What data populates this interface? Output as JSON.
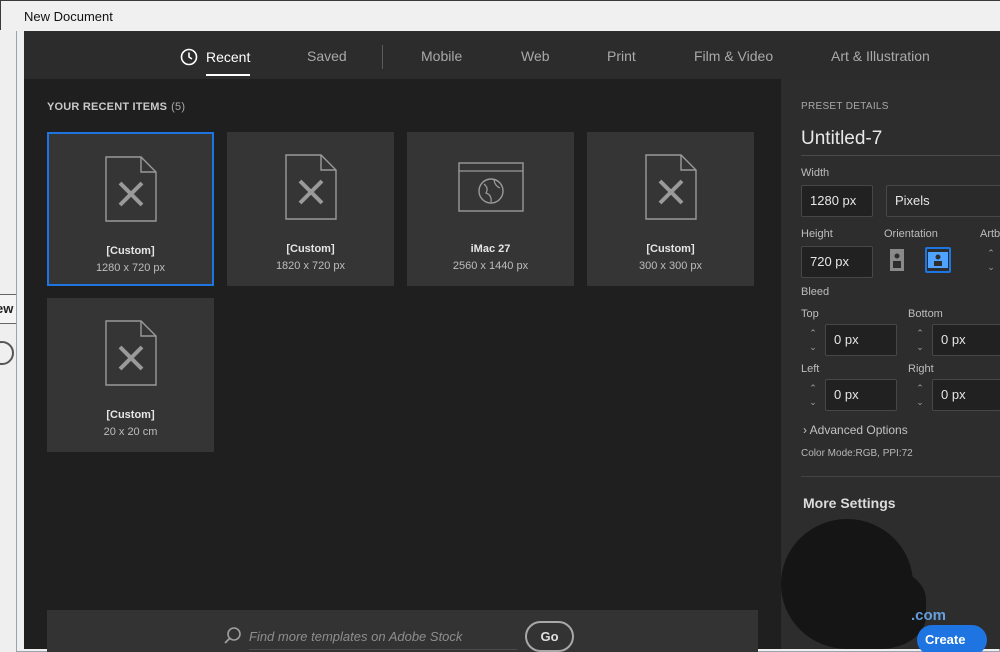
{
  "window": {
    "title": "New Document"
  },
  "tabs": [
    {
      "label": "Recent",
      "active": true
    },
    {
      "label": "Saved"
    },
    {
      "label": "Mobile"
    },
    {
      "label": "Web"
    },
    {
      "label": "Print"
    },
    {
      "label": "Film & Video"
    },
    {
      "label": "Art & Illustration"
    }
  ],
  "recent": {
    "heading": "YOUR RECENT ITEMS",
    "count": "(5)",
    "items": [
      {
        "name": "[Custom]",
        "dims": "1280 x 720 px",
        "icon": "document-ruler-icon",
        "selected": true
      },
      {
        "name": "[Custom]",
        "dims": "1820 x 720 px",
        "icon": "document-ruler-icon"
      },
      {
        "name": "iMac 27",
        "dims": "2560 x 1440 px",
        "icon": "browser-globe-icon"
      },
      {
        "name": "[Custom]",
        "dims": "300 x 300 px",
        "icon": "document-ruler-icon"
      },
      {
        "name": "[Custom]",
        "dims": "20 x 20 cm",
        "icon": "document-ruler-icon"
      }
    ]
  },
  "search": {
    "placeholder": "Find more templates on Adobe Stock",
    "go_label": "Go"
  },
  "preset": {
    "section_label": "PRESET DETAILS",
    "name": "Untitled-7",
    "width_label": "Width",
    "width_value": "1280 px",
    "unit_value": "Pixels",
    "height_label": "Height",
    "height_value": "720 px",
    "orientation_label": "Orientation",
    "artboards_label": "Artb",
    "bleed_label": "Bleed",
    "bleed_top_label": "Top",
    "bleed_top": "0 px",
    "bleed_bottom_label": "Bottom",
    "bleed_bottom": "0 px",
    "bleed_left_label": "Left",
    "bleed_left": "0 px",
    "bleed_right_label": "Right",
    "bleed_right": "0 px",
    "advanced_label": "Advanced Options",
    "color_mode": "Color Mode:RGB, PPI:72",
    "more_settings": "More Settings",
    "create_label": "Create",
    "watermark": ".com"
  },
  "background": {
    "left_fragment": "ew"
  },
  "colors": {
    "accent": "#1e74e0",
    "panel": "#2d2d2d",
    "main_bg": "#1f1f1f",
    "card": "#353535"
  }
}
